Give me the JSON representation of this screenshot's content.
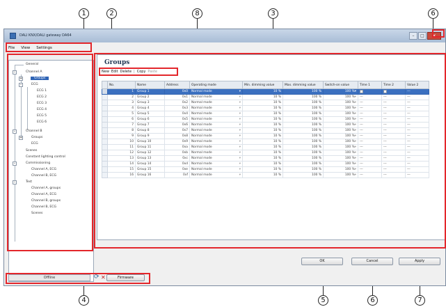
{
  "window": {
    "title": "DALI KNX/DALI gateway DA64"
  },
  "window_controls": {
    "minimize": "–",
    "maximize": "□",
    "close": "✕"
  },
  "menu": {
    "items": [
      "File",
      "View",
      "Settings"
    ]
  },
  "tree": {
    "general": "General",
    "channel_a": "Channel A",
    "groups_a": "Groups",
    "ecg": "ECG",
    "ecg_items": [
      "ECG 1",
      "ECG 2",
      "ECG 3",
      "ECG 4",
      "ECG 5",
      "ECG 6"
    ],
    "channel_b": "Channel B",
    "groups_b": "Groups",
    "ecg_b": "ECG",
    "scenes": "Scenes",
    "const_light": "Constant lighting control",
    "commissioning": "Commissioning",
    "comm_items": [
      "Channel A, ECG",
      "Channel B, ECG"
    ],
    "test": "Test",
    "test_items": [
      "Channel A, groups",
      "Channel A, ECG",
      "Channel B, groups",
      "Channel B, ECG",
      "Scenes"
    ]
  },
  "content": {
    "heading": "Groups"
  },
  "toolbar": {
    "new": "New",
    "edit": "Edit",
    "delete": "Delete",
    "copy": "Copy",
    "paste": "Paste"
  },
  "grid": {
    "columns": [
      "No.",
      "Name",
      "Address",
      "Operating mode",
      "Min. dimming value",
      "Max. dimming value",
      "Switch-on value",
      "Time 1",
      "Time 2",
      "Value 2"
    ],
    "rows": [
      [
        "1",
        "Group 1",
        "0x0",
        "Normal mode",
        "10 %",
        "100 %",
        "100 %"
      ],
      [
        "2",
        "Group 2",
        "0x1",
        "Normal mode",
        "10 %",
        "100 %",
        "100 %"
      ],
      [
        "3",
        "Group 3",
        "0x2",
        "Normal mode",
        "10 %",
        "100 %",
        "100 %"
      ],
      [
        "4",
        "Group 4",
        "0x3",
        "Normal mode",
        "10 %",
        "100 %",
        "100 %"
      ],
      [
        "5",
        "Group 5",
        "0x4",
        "Normal mode",
        "10 %",
        "100 %",
        "100 %"
      ],
      [
        "6",
        "Group 6",
        "0x5",
        "Normal mode",
        "10 %",
        "100 %",
        "100 %"
      ],
      [
        "7",
        "Group 7",
        "0x6",
        "Normal mode",
        "10 %",
        "100 %",
        "100 %"
      ],
      [
        "8",
        "Group 8",
        "0x7",
        "Normal mode",
        "10 %",
        "100 %",
        "100 %"
      ],
      [
        "9",
        "Group 9",
        "0x8",
        "Normal mode",
        "10 %",
        "100 %",
        "100 %"
      ],
      [
        "10",
        "Group 10",
        "0x9",
        "Normal mode",
        "10 %",
        "100 %",
        "100 %"
      ],
      [
        "11",
        "Group 11",
        "0xa",
        "Normal mode",
        "10 %",
        "100 %",
        "100 %"
      ],
      [
        "12",
        "Group 12",
        "0xb",
        "Normal mode",
        "10 %",
        "100 %",
        "100 %"
      ],
      [
        "13",
        "Group 13",
        "0xc",
        "Normal mode",
        "10 %",
        "100 %",
        "100 %"
      ],
      [
        "14",
        "Group 14",
        "0xd",
        "Normal mode",
        "10 %",
        "100 %",
        "100 %"
      ],
      [
        "15",
        "Group 15",
        "0xe",
        "Normal mode",
        "10 %",
        "100 %",
        "100 %"
      ],
      [
        "16",
        "Group 16",
        "0xf",
        "Normal mode",
        "10 %",
        "100 %",
        "100 %"
      ]
    ],
    "placeholder": "---"
  },
  "buttons": {
    "ok": "OK",
    "cancel": "Cancel",
    "apply": "Apply"
  },
  "statusbar": {
    "status": "Offline",
    "firmware": "Firmware"
  },
  "callouts": {
    "c1": "1",
    "c2": "2",
    "c3": "3",
    "c4": "4",
    "c5": "5",
    "c6a": "6",
    "c6b": "6",
    "c7": "7",
    "c8": "8"
  },
  "colors": {
    "highlight": "#e3262b",
    "selection": "#3b70c0",
    "title_gradient": "#a9bdd6"
  }
}
